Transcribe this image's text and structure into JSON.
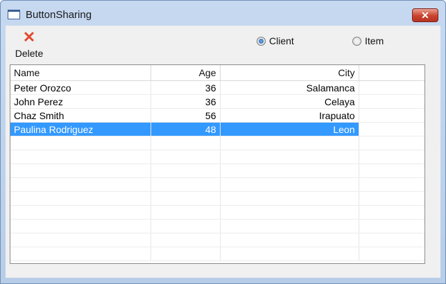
{
  "window": {
    "title": "ButtonSharing",
    "close_label": "✕"
  },
  "toolbar": {
    "delete_icon": "✕",
    "delete_label": "Delete"
  },
  "radios": [
    {
      "label": "Client",
      "checked": true
    },
    {
      "label": "Item",
      "checked": false
    }
  ],
  "table": {
    "columns": [
      "Name",
      "Age",
      "City"
    ],
    "rows": [
      [
        "Peter Orozco",
        "36",
        "Salamanca"
      ],
      [
        "John Perez",
        "36",
        "Celaya"
      ],
      [
        "Chaz Smith",
        "56",
        "Irapuato"
      ],
      [
        "Paulina Rodriguez",
        "48",
        "Leon"
      ]
    ],
    "selected_row": 3
  },
  "colors": {
    "selection": "#3399ff",
    "delete_icon": "#e04a2e",
    "close_button": "#c9422d"
  }
}
